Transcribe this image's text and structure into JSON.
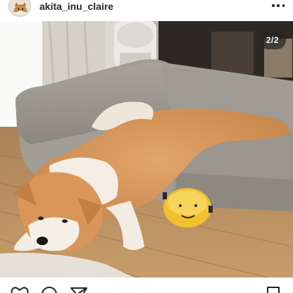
{
  "post": {
    "username": "akita_inu_claire",
    "image_counter": "2/2",
    "image_alt": "Akita dog lying on a gray sofa bed with a yellow plush toy"
  },
  "icons": {
    "more": "more-horizontal-icon",
    "like": "heart-icon",
    "comment": "comment-bubble-icon",
    "share": "paper-plane-icon",
    "save": "bookmark-icon"
  },
  "colors": {
    "text": "#262626",
    "background": "#ffffff",
    "counter_bg": "#262626"
  }
}
